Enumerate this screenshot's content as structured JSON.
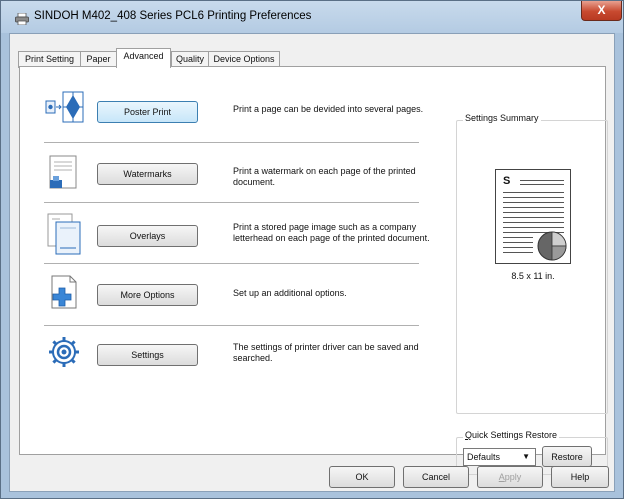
{
  "window": {
    "title": "SINDOH M402_408 Series PCL6 Printing Preferences",
    "close_label": "X",
    "printer_icon": "printer-icon"
  },
  "tabs": [
    {
      "label": "Print Setting"
    },
    {
      "label": "Paper"
    },
    {
      "label": "Advanced",
      "active": true
    },
    {
      "label": "Quality"
    },
    {
      "label": "Device Options"
    }
  ],
  "features": [
    {
      "button": "Poster Print",
      "description": "Print a page can be devided into several pages.",
      "icon": "poster-icon"
    },
    {
      "button": "Watermarks",
      "description": "Print a watermark on each page of the printed document.",
      "icon": "watermark-icon"
    },
    {
      "button": "Overlays",
      "description": "Print a stored page image such as a company letterhead on each page of the printed document.",
      "icon": "overlay-icon"
    },
    {
      "button": "More Options",
      "description": "Set up an additional options.",
      "icon": "more-options-icon"
    },
    {
      "button": "Settings",
      "description": "The settings of printer driver can be saved and searched.",
      "icon": "settings-gear-icon"
    }
  ],
  "summary": {
    "label": "Settings Summary",
    "doc_letter": "S",
    "paper_size": "8.5 x 11 in."
  },
  "quick_settings": {
    "label_first": "Q",
    "label_rest": "uick Settings Restore",
    "selected": "Defaults",
    "restore_label": "Restore"
  },
  "footer": {
    "ok": "OK",
    "cancel": "Cancel",
    "apply_first": "A",
    "apply_rest": "pply",
    "help": "Help"
  },
  "colors": {
    "accent_blue": "#2b6cb8",
    "titlebar": "#b9cfe6",
    "close_red": "#c84a30"
  }
}
